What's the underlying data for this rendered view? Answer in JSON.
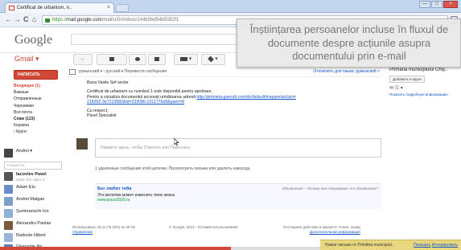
{
  "browser": {
    "tab_title": "Certificat de urbanism, n..",
    "tab_close": "×",
    "url_scheme": "https://",
    "url_host": "mail.google.com",
    "url_path": "/mail/u/0/#inbox/144b0bd54b5082f1",
    "nav": {
      "back": "←",
      "forward": "→",
      "reload": "C",
      "home": "⌂"
    },
    "window_buttons": {
      "minimize": "—",
      "maximize": "□",
      "close": "×"
    }
  },
  "gmail": {
    "logo": "Google",
    "label": "Gmail ▾",
    "toolbar": {
      "back": "←"
    }
  },
  "sidebar": {
    "compose": "НАПИСАТЬ",
    "items": [
      {
        "label": "Входящие (1)"
      },
      {
        "label": "Важные"
      },
      {
        "label": "Отправленные"
      },
      {
        "label": "Черновики"
      },
      {
        "label": "Вся почта"
      },
      {
        "label": "Спам (123)"
      },
      {
        "label": "Корзина"
      },
      {
        "label": "› Круги"
      }
    ],
    "me": "Andrei ▾",
    "chat_search": "Новый чат",
    "contacts": [
      {
        "name": "Iacovlev Pavel",
        "sub": "watch the video fi..",
        "color": "#555555"
      },
      {
        "name": "Adam Elu",
        "sub": "",
        "color": "#6a8cc7"
      },
      {
        "name": "Andrei Malgan",
        "sub": "",
        "color": "#7aa0c8"
      },
      {
        "name": "Şumleanschi Ion",
        "sub": "",
        "color": "#8fb0d8"
      },
      {
        "name": "Alexandru Pantaz",
        "sub": "",
        "color": "#7a5a3a"
      },
      {
        "name": "Radoste Hibert",
        "sub": "",
        "color": "#9ab4d8"
      },
      {
        "name": "Ghenadie Ilin",
        "sub": "",
        "color": "#5d7fb5"
      }
    ]
  },
  "conversation": {
    "lang_bar": "румынский ▾  ›  русский ▾   Перевести сообщение",
    "translate_off": "Отключить для языка: румынский ×",
    "greeting": "Buna Vasile Sef sectie",
    "body_line1": "Certificat de urbanism cu numărul 1 este disponibil pentru aprobare.",
    "body_line2_prefix": "Pentru a vizualiza documentul accesați următoarea adresă",
    "body_link": "http://primaria.gsecult.com/dc/default/mapare/act/act=",
    "body_line3": "218262-3e7213582&id=233086-2311776e8&paen=8",
    "sign1": "Cu respect,",
    "sign2": "Pavel Specialist",
    "reply_placeholder": "Нажмите здесь, чтобы Ответить или Переслать",
    "deleted_text": "1 удаленные сообщения этой цепочки. Просмотреть письма или удалить навсегда.",
    "ad_title": "Бог любит тебя",
    "ad_desc": "Эта молитва может изменить твою жизнь",
    "ad_url": "www.jesus2020.ru",
    "ad_note": "Объявление – Почему мне показывают это объявление?",
    "footer_left": "Использовано 16,11 ГБ (9%) из 30 ГБ",
    "footer_manage": "Управление",
    "footer_center": "© Google, 2014 - Условия использования",
    "footer_right": "Последние действия в аккаунте: 9 мин. назад",
    "footer_details": "Дополнительная информация"
  },
  "right_panel": {
    "title": "Primăria municipiului Chiş..",
    "add_button": "Добавить в круги",
    "icons": "✉ ☷ ▾",
    "link": "Показать подробную информацию"
  },
  "callout": {
    "text": "Înștiințarea persoanelor incluse în fluxul de documente despre acțiunile asupra documentului prin e-mail"
  },
  "notification": {
    "text": "Новое письмо от Primăria municipiul..",
    "show": "Показать",
    "ignore": "Игнорировать"
  },
  "progress": {
    "value_percent": 72
  }
}
